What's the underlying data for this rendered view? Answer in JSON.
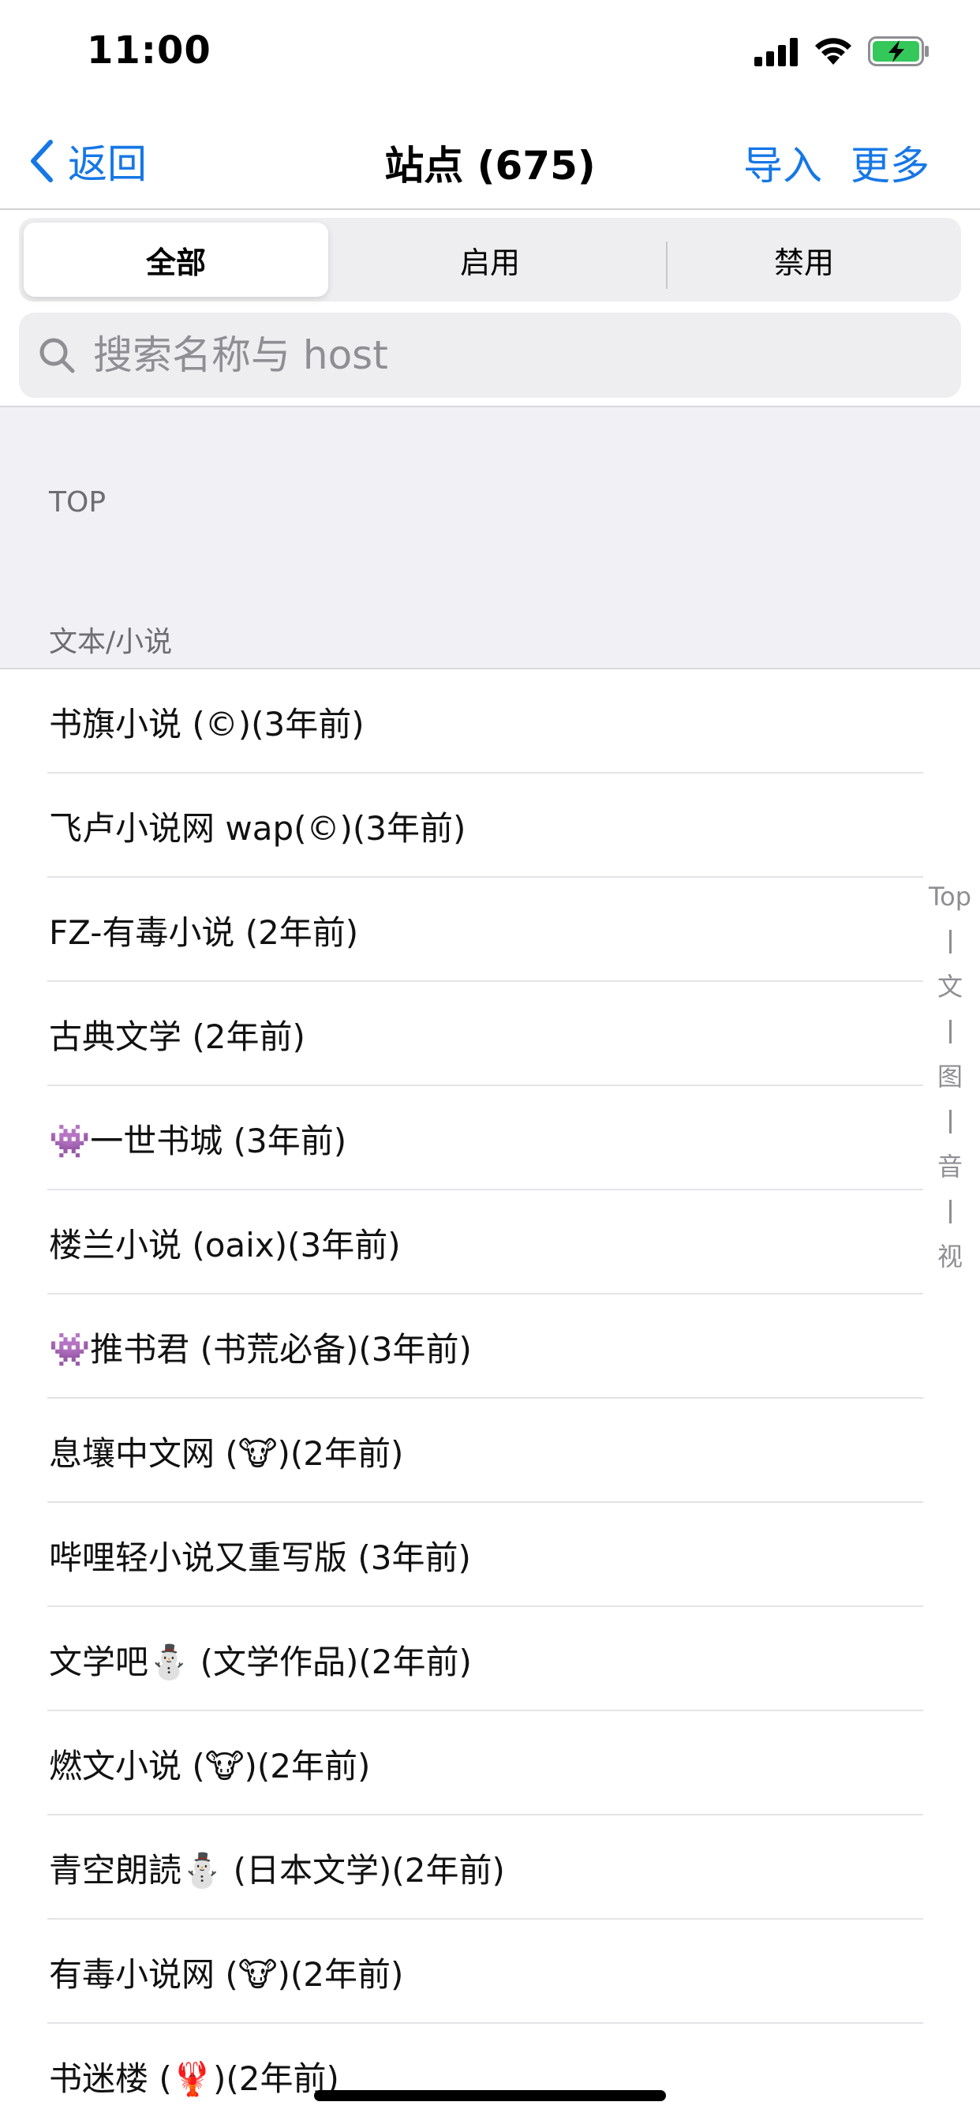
{
  "status": {
    "time": "11:00"
  },
  "nav": {
    "back_label": "返回",
    "title": "站点 (675)",
    "import_label": "导入",
    "more_label": "更多"
  },
  "tabs": [
    "全部",
    "启用",
    "禁用"
  ],
  "search": {
    "placeholder": "搜索名称与 host"
  },
  "sections": {
    "top": "TOP",
    "category": "文本/小说"
  },
  "items": [
    "书旗小说 (©)(3年前)",
    "飞卢小说网 wap(©)(3年前)",
    "FZ-有毒小说 (2年前)",
    "古典文学 (2年前)",
    "👾一世书城 (3年前)",
    "楼兰小说 (oaix)(3年前)",
    "👾推书君 (书荒必备)(3年前)",
    "息壤中文网 (🐮)(2年前)",
    "哔哩轻小说又重写版 (3年前)",
    "文学吧⛄ (文学作品)(2年前)",
    "燃文小说 (🐮)(2年前)",
    "青空朗読⛄ (日本文学)(2年前)",
    "有毒小说网 (🐮)(2年前)",
    "书迷楼 (🦞)(2年前)"
  ],
  "index": [
    "Top",
    "文",
    "图",
    "音",
    "视"
  ],
  "colors": {
    "accent": "#1677e6",
    "battery": "#34c759"
  }
}
